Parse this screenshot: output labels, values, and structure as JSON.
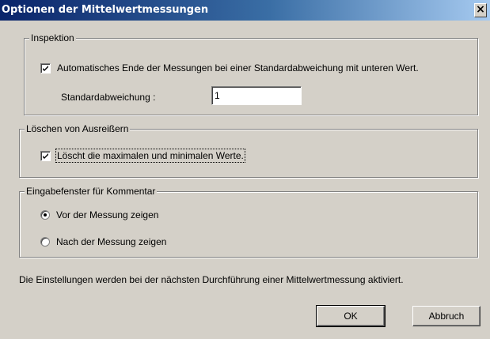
{
  "window": {
    "title": "Optionen der Mittelwertmessungen",
    "close_glyph": "×"
  },
  "inspection": {
    "legend": "Inspektion",
    "auto_end_label": "Automatisches Ende der Messungen bei einer Standardabweichung mit unteren Wert.",
    "auto_end_checked": true,
    "std_label": "Standardabweichung :",
    "std_value": "1"
  },
  "outliers": {
    "legend": "Löschen von Ausreißern",
    "delete_label": "Löscht die maximalen und minimalen Werte.",
    "delete_checked": true
  },
  "comment_window": {
    "legend": "Eingabefenster für Kommentar",
    "options": [
      {
        "label": "Vor der Messung zeigen",
        "selected": true
      },
      {
        "label": "Nach der Messung zeigen",
        "selected": false
      }
    ]
  },
  "info_text": "Die Einstellungen werden bei der nächsten Durchführung einer Mittelwertmessung aktiviert.",
  "buttons": {
    "ok": "OK",
    "cancel": "Abbruch"
  }
}
